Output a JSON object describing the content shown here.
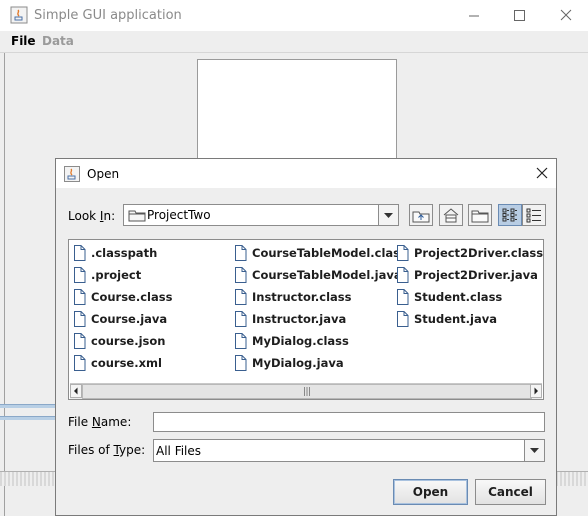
{
  "window": {
    "title": "Simple GUI application",
    "menus": [
      "File",
      "Data"
    ]
  },
  "dialog": {
    "title": "Open",
    "look_in_label_pre": "Look ",
    "look_in_label_mnemonic": "I",
    "look_in_label_post": "n:",
    "look_in_value": "ProjectTwo",
    "toolbar_icons": [
      "up-one-level-icon",
      "home-icon",
      "new-folder-icon",
      "list-view-icon",
      "details-view-icon"
    ],
    "files": {
      "col1": [
        ".classpath",
        ".project",
        "Course.class",
        "Course.java",
        "course.json",
        "course.xml"
      ],
      "col2": [
        "CourseTableModel.class",
        "CourseTableModel.java",
        "Instructor.class",
        "Instructor.java",
        "MyDialog.class",
        "MyDialog.java"
      ],
      "col3": [
        "Project2Driver.class",
        "Project2Driver.java",
        "Student.class",
        "Student.java"
      ]
    },
    "file_name_label_pre": "File ",
    "file_name_label_mnemonic": "N",
    "file_name_label_post": "ame:",
    "file_name_value": "",
    "files_of_type_label_pre": "Files of ",
    "files_of_type_label_mnemonic": "T",
    "files_of_type_label_post": "ype:",
    "files_of_type_value": "All Files",
    "open_label": "Open",
    "cancel_label": "Cancel"
  }
}
